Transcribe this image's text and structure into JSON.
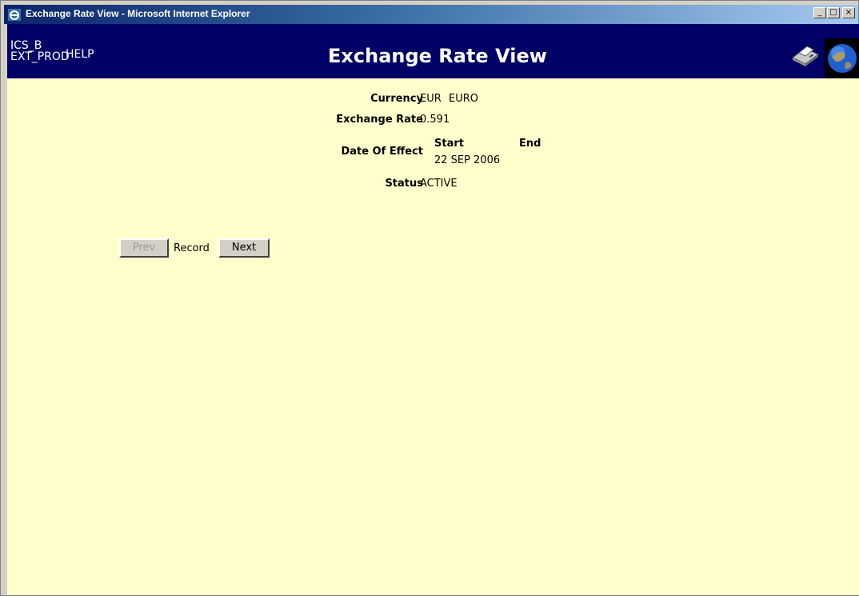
{
  "window": {
    "title": "Exchange Rate View - Microsoft Internet Explorer",
    "minimize": "_",
    "maximize": "□",
    "close": "×"
  },
  "header": {
    "environment": "ICS_B\nEXT_PROD",
    "env_line1": "ICS_B",
    "env_line2": "EXT_PROD",
    "help": "HELP",
    "title": "Exchange Rate View",
    "print_icon": "printer-icon",
    "globe_icon": "globe-icon"
  },
  "record": {
    "currency_label": "Currency",
    "currency_code": "EUR",
    "currency_name": "EURO",
    "rate_label": "Exchange Rate",
    "rate_value": "0.591",
    "date_label": "Date Of Effect",
    "start_label": "Start",
    "end_label": "End",
    "start_date": "22 SEP 2006",
    "status_label": "Status",
    "status_value": "ACTIVE"
  },
  "nav": {
    "prev": "Prev",
    "record": "Record",
    "next": "Next"
  },
  "colors": {
    "header_bg": "#000066",
    "page_bg": "#ffffcc",
    "titlebar_start": "#0a246a",
    "titlebar_end": "#a6caf0"
  }
}
